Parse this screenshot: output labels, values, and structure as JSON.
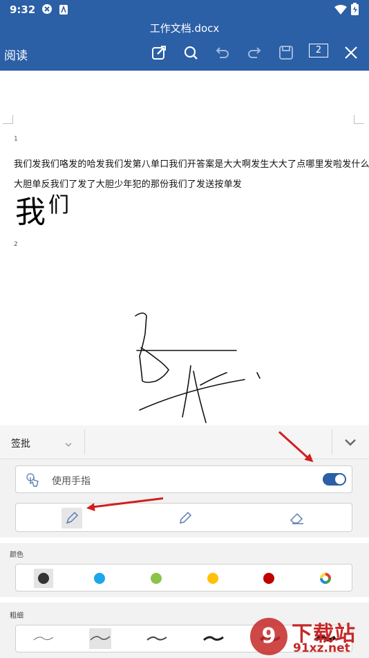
{
  "status_bar": {
    "time": "9:32"
  },
  "title_bar": {
    "doc_title": "工作文档.docx",
    "mode_label": "阅读",
    "page_count": "2",
    "icons": [
      "edit-icon",
      "search-icon",
      "undo-icon",
      "redo-icon",
      "save-icon",
      "page-count-icon",
      "close-icon"
    ]
  },
  "document": {
    "page1_number": "1",
    "paragraph1": "我们发我们咯发的哈发我们发第八单口我们开答案是大大啊发生大大了点哪里发啦发什么",
    "paragraph2": "大胆单反我们了发了大胆少年犯的那份我们了发送按单发",
    "big_text_main": "我",
    "big_text_small": "们",
    "page2_number": "2"
  },
  "panel": {
    "toolbar_label": "签批",
    "finger_toggle_label": "使用手指",
    "finger_toggle_on": true,
    "tools": [
      "pen-icon",
      "pencil-icon",
      "eraser-icon"
    ],
    "color_label": "颜色",
    "colors": [
      "#333333",
      "#1aa7ec",
      "#8bc34a",
      "#ffc107",
      "#c00000",
      "multi"
    ],
    "thickness_label": "粗细"
  },
  "watermark": {
    "text_big": "下载站",
    "text_url": "91xz.net"
  }
}
